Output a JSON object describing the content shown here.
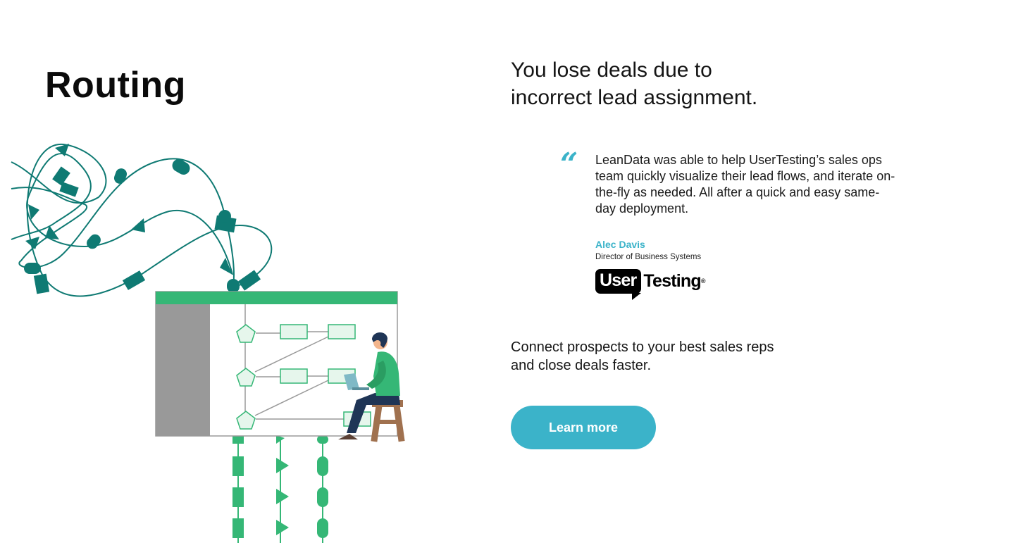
{
  "page": {
    "title": "Routing",
    "headline_line1": "You lose deals due to",
    "headline_line2": "incorrect lead assignment."
  },
  "testimonial": {
    "quote_mark": "“",
    "quote": "LeanData was able to help UserTesting’s sales ops team quickly visualize their lead flows, and iterate on-the-fly as needed. All after a quick and easy same-day deployment.",
    "author": "Alec Davis",
    "role": "Director of Business Systems",
    "logo": {
      "part1": "User",
      "part2": "Testing",
      "reg": "®"
    }
  },
  "cta": {
    "description_line1": "Connect prospects to your best sales reps",
    "description_line2": "and close deals faster.",
    "button_label": "Learn more"
  },
  "colors": {
    "accent": "#3bb3c9",
    "teal_dark": "#0f7a73",
    "green": "#35b776",
    "panel_gray": "#999999"
  },
  "illustration": {
    "name": "routing-flowchart-illustration"
  }
}
